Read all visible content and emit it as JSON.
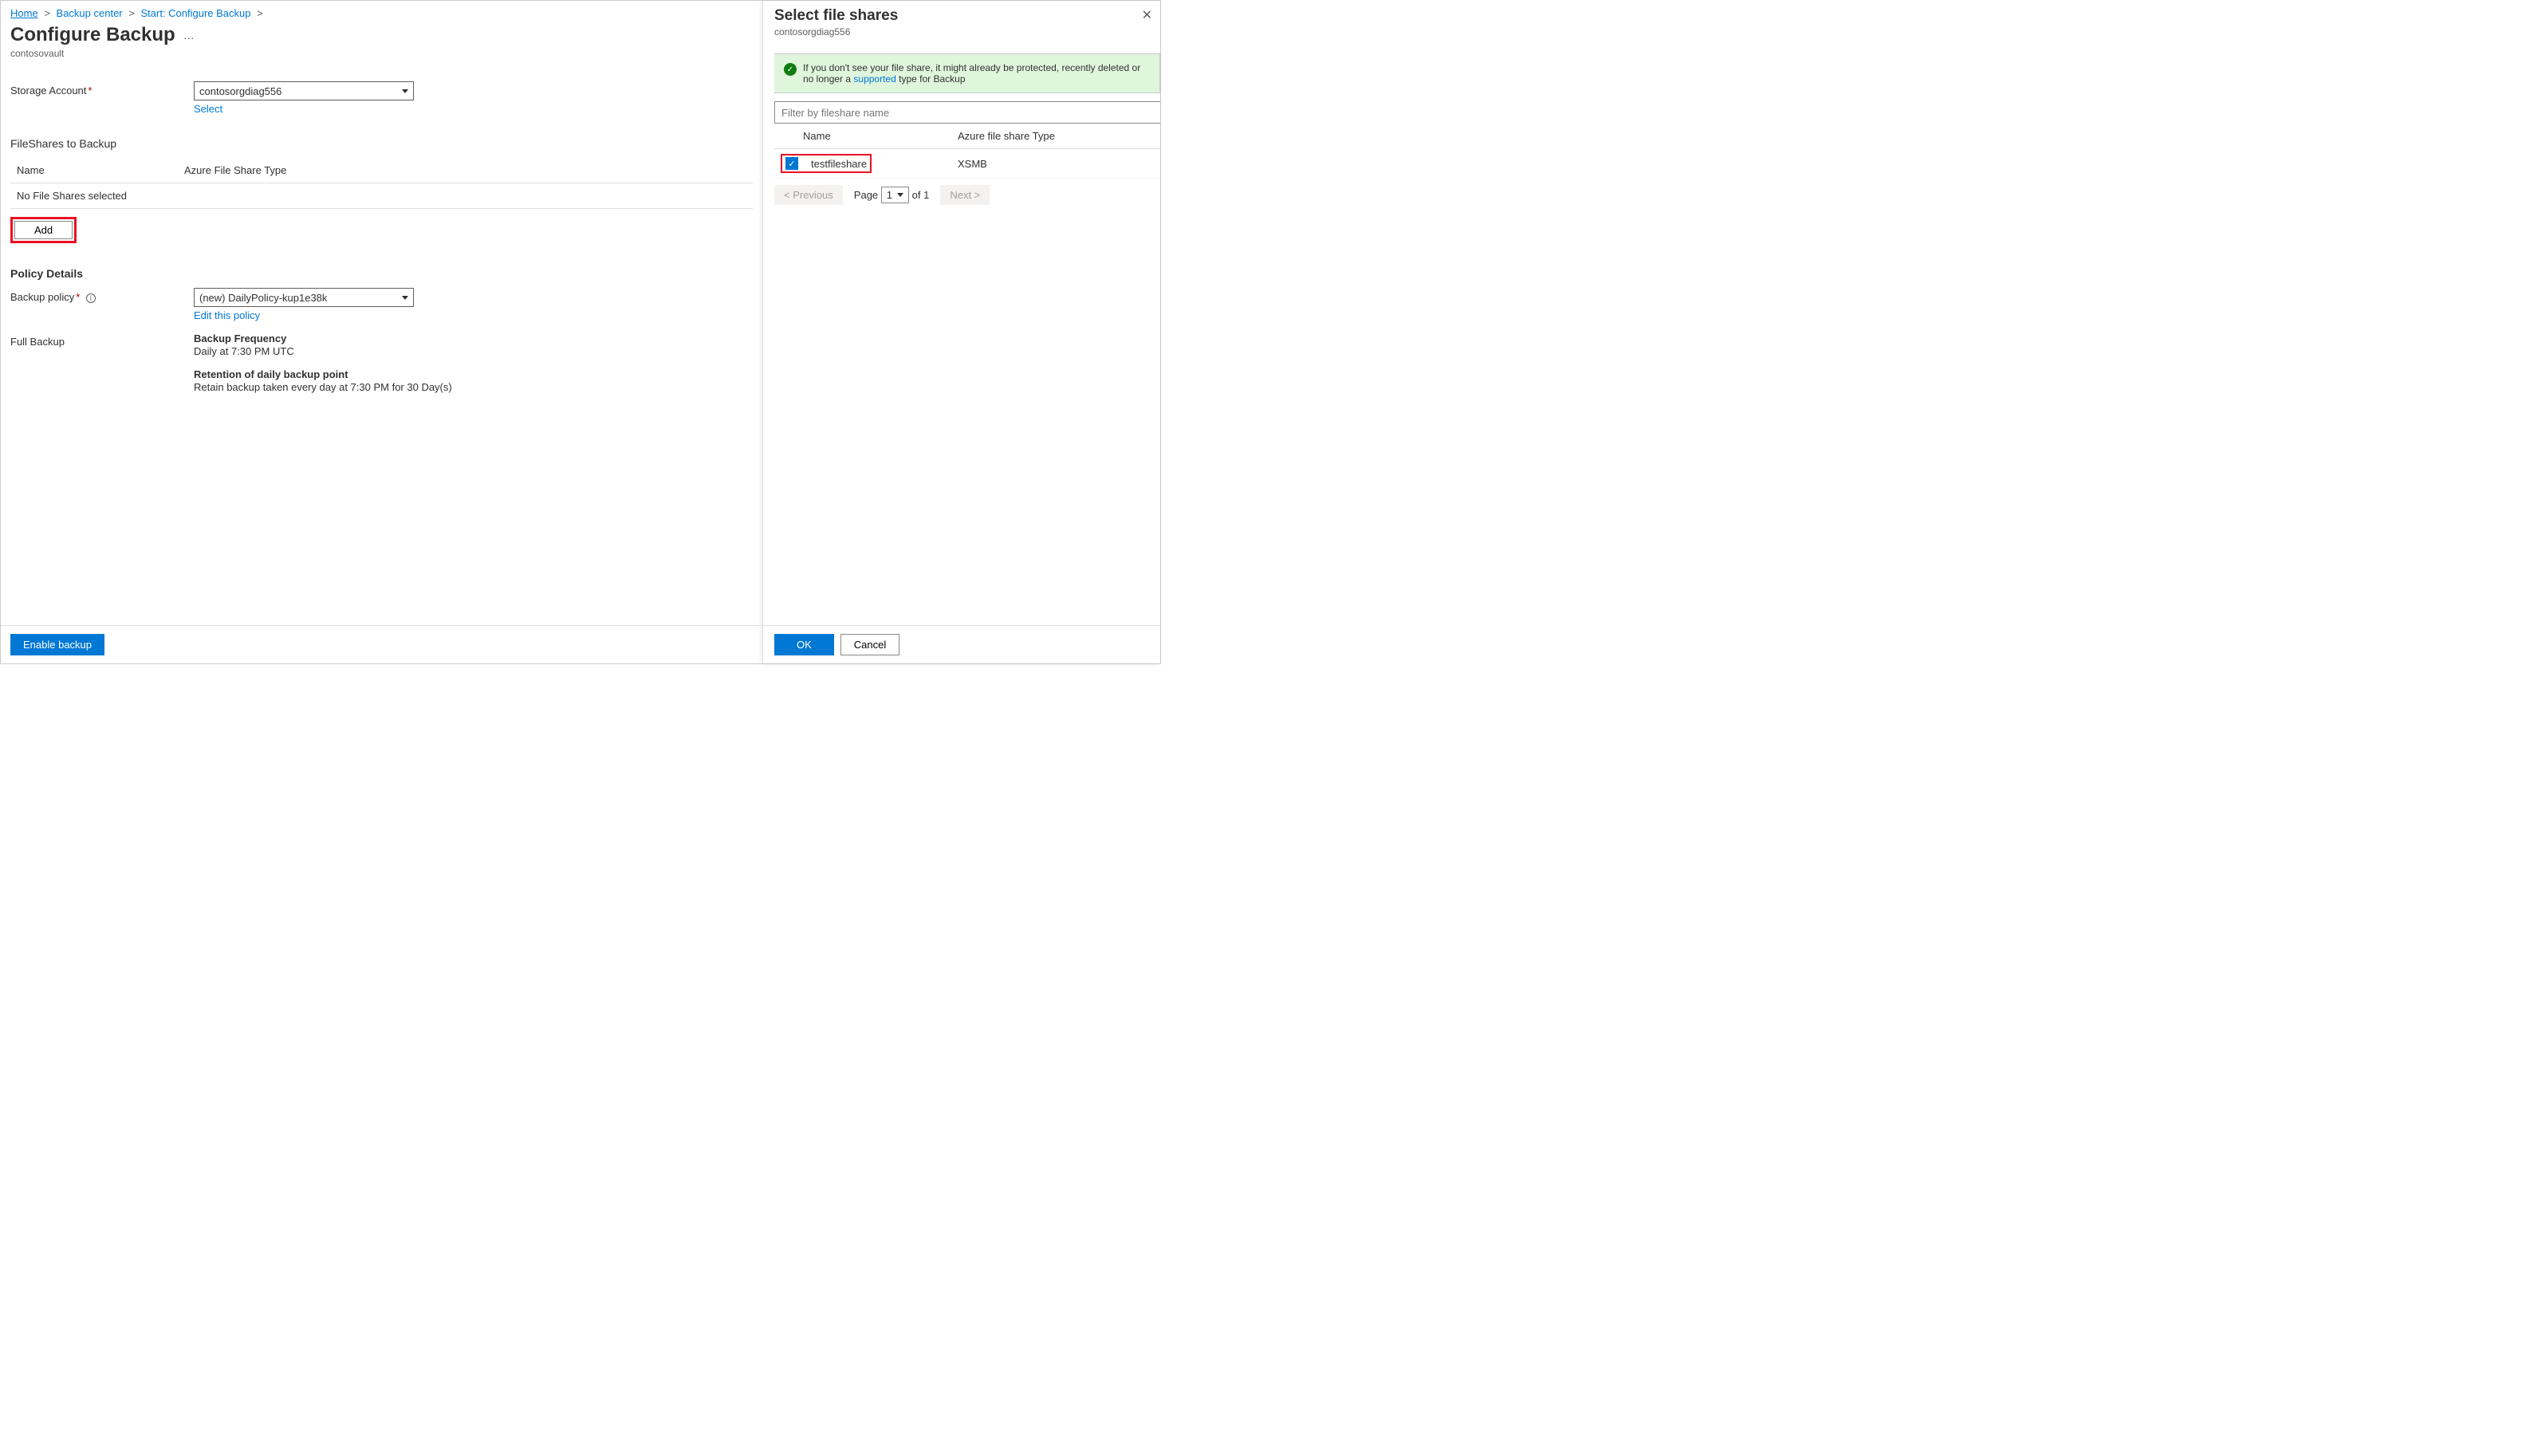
{
  "breadcrumb": {
    "home": "Home",
    "backup_center": "Backup center",
    "start": "Start: Configure Backup"
  },
  "page": {
    "title": "Configure Backup",
    "subtitle": "contosovault"
  },
  "storage_account": {
    "label": "Storage Account",
    "value": "contosorgdiag556",
    "select_link": "Select"
  },
  "fileshares": {
    "section_title": "FileShares to Backup",
    "col_name": "Name",
    "col_type": "Azure File Share Type",
    "empty": "No File Shares selected",
    "add_button": "Add"
  },
  "policy": {
    "section_title": "Policy Details",
    "backup_policy_label": "Backup policy",
    "backup_policy_value": "(new) DailyPolicy-kup1e38k",
    "edit_link": "Edit this policy",
    "full_backup_label": "Full Backup",
    "freq_label": "Backup Frequency",
    "freq_value": "Daily at 7:30 PM UTC",
    "retention_label": "Retention of daily backup point",
    "retention_value": "Retain backup taken every day at 7:30 PM for 30 Day(s)"
  },
  "footer": {
    "enable": "Enable backup"
  },
  "flyout": {
    "title": "Select file shares",
    "subtitle": "contosorgdiag556",
    "info_text_1": "If you don't see your file share, it might already be protected, recently deleted or no longer a ",
    "info_link": "supported",
    "info_text_2": " type for Backup",
    "filter_placeholder": "Filter by fileshare name",
    "col_name": "Name",
    "col_type": "Azure file share Type",
    "rows": [
      {
        "name": "testfileshare",
        "type": "XSMB",
        "checked": true
      }
    ],
    "prev": "< Previous",
    "page_label": "Page",
    "page_num": "1",
    "page_of": "of 1",
    "next": "Next >",
    "ok": "OK",
    "cancel": "Cancel"
  }
}
